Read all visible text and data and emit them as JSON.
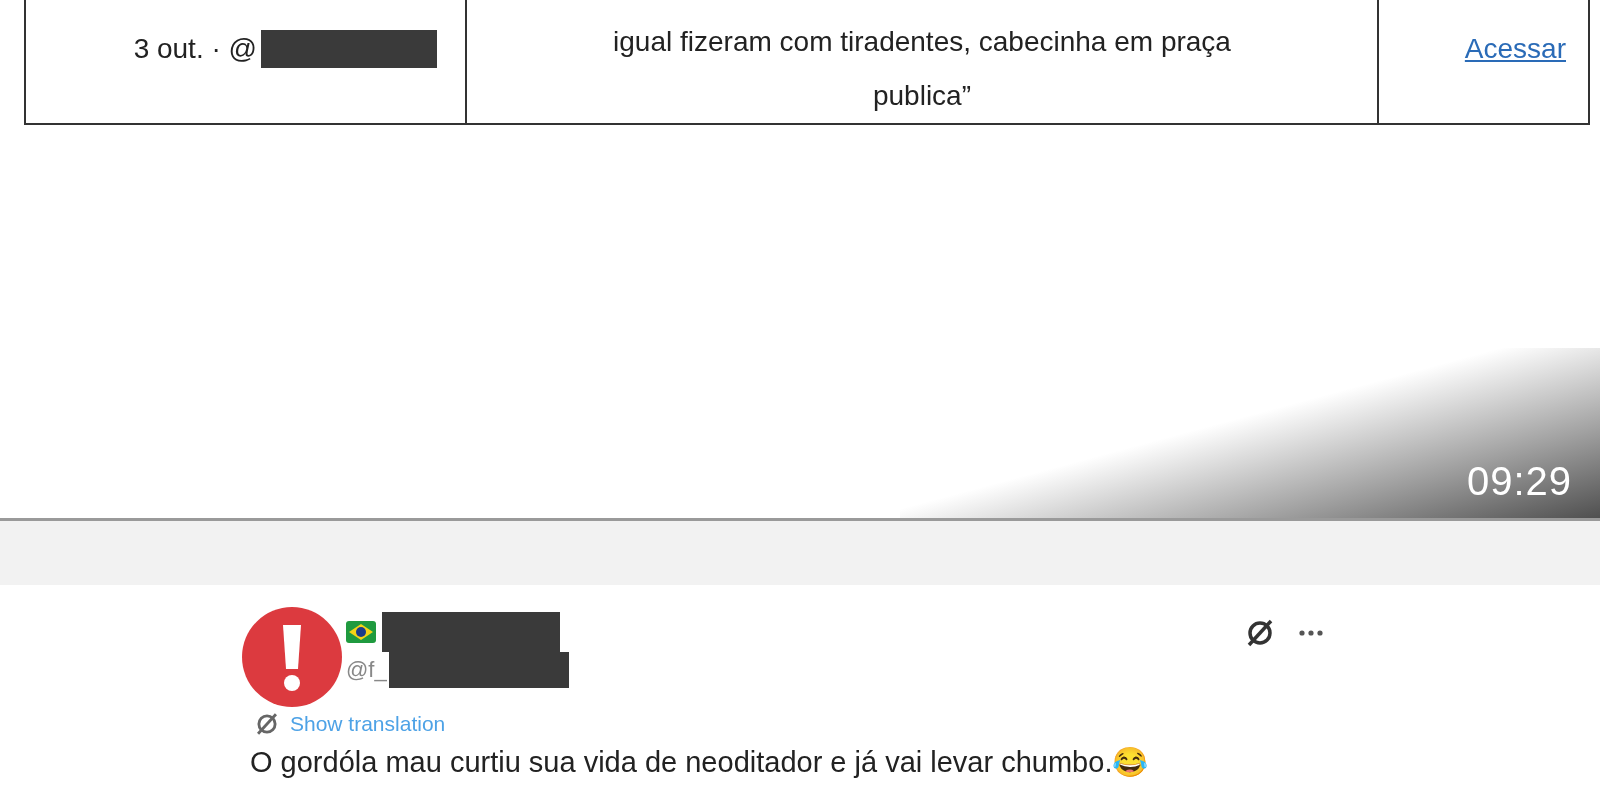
{
  "document_table": {
    "rows": [
      {
        "date_handle": "3 out. · @",
        "text": "igual fizeram com tiradentes, cabecinha em praça\npublica”",
        "link": "Acessar"
      }
    ]
  },
  "video": {
    "timestamp": "09:29"
  },
  "tweet": {
    "handle": "@f_",
    "show_translation": "Show translation",
    "text": "O gordóla mau curtiu sua vida de neoditador e já vai levar chumbo.😂"
  }
}
